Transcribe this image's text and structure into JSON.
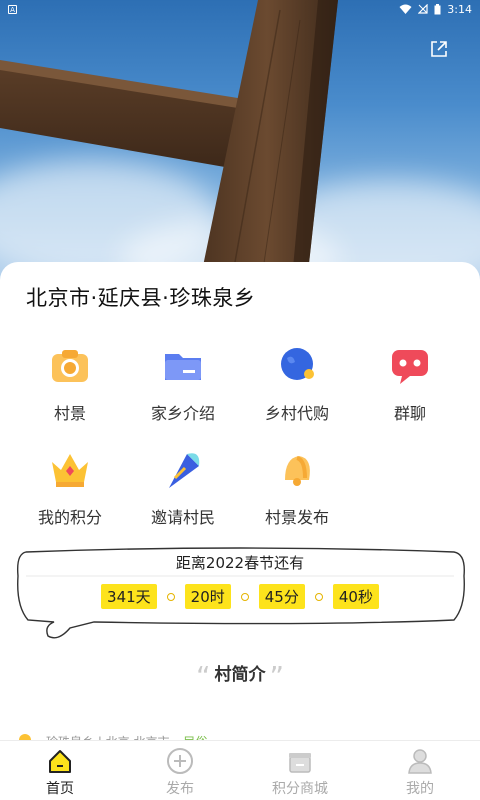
{
  "status_bar": {
    "time": "3:14"
  },
  "location": "北京市·延庆县·珍珠泉乡",
  "grid": [
    {
      "label": "村景",
      "icon": "camera-icon"
    },
    {
      "label": "家乡介绍",
      "icon": "folder-icon"
    },
    {
      "label": "乡村代购",
      "icon": "planet-icon"
    },
    {
      "label": "群聊",
      "icon": "chat-icon"
    },
    {
      "label": "我的积分",
      "icon": "crown-icon"
    },
    {
      "label": "邀请村民",
      "icon": "cone-icon"
    },
    {
      "label": "村景发布",
      "icon": "bell-icon"
    }
  ],
  "countdown": {
    "title": "距离2022春节还有",
    "days": "341天",
    "hours": "20时",
    "minutes": "45分",
    "seconds": "40秒"
  },
  "intro": {
    "title": "村简介",
    "open_quote": "“",
    "close_quote": "”"
  },
  "peek_row": {
    "text": "珍珠泉乡 | 北京 北京市",
    "tag": "民俗"
  },
  "tabs": [
    {
      "label": "首页",
      "icon": "home-icon",
      "active": true
    },
    {
      "label": "发布",
      "icon": "plus-circle-icon",
      "active": false
    },
    {
      "label": "积分商城",
      "icon": "gift-box-icon",
      "active": false
    },
    {
      "label": "我的",
      "icon": "profile-icon",
      "active": false
    }
  ],
  "colors": {
    "accent": "#fde31c",
    "tag_green": "#7cbf4c",
    "active_tab": "#222222",
    "inactive_tab": "#aaaaaa"
  }
}
